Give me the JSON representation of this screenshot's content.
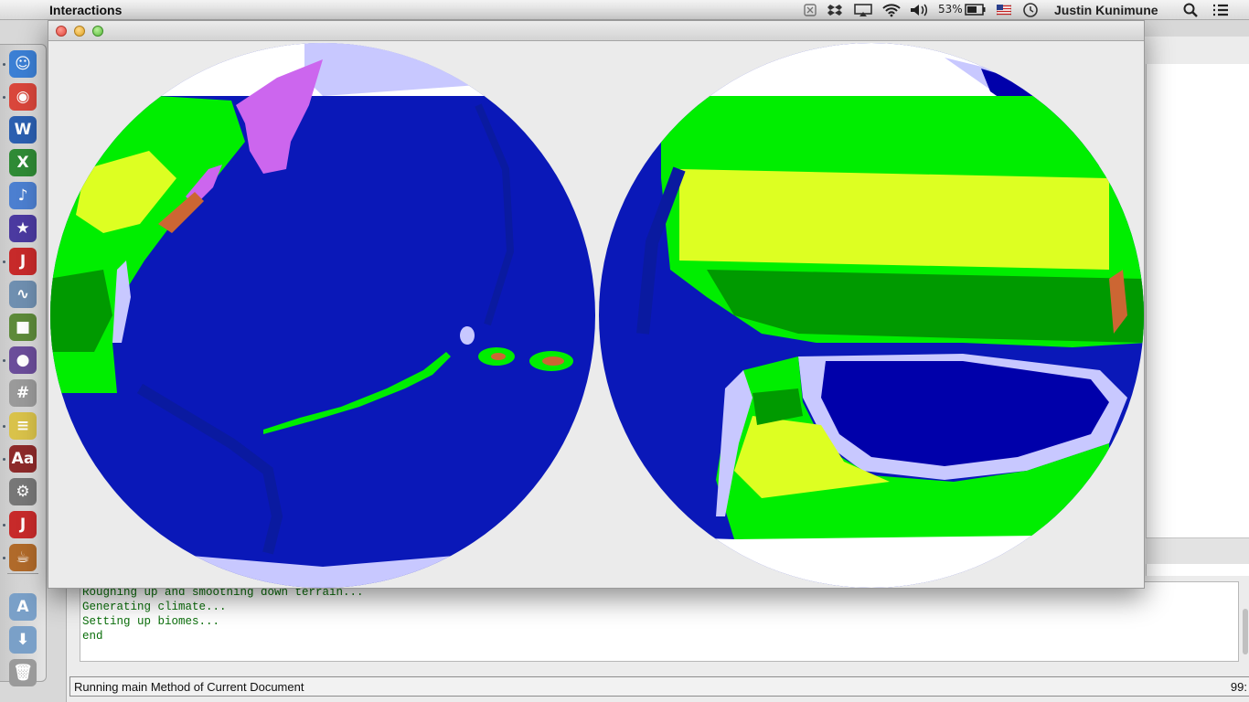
{
  "menubar": {
    "apple_glyph": "",
    "app_name": "Interactions",
    "battery_percent": "53%",
    "user_name": "Justin Kunimune",
    "status_icons": [
      "shield-icon",
      "dropbox-icon",
      "airplay-icon",
      "wifi-icon",
      "volume-icon",
      "battery-icon",
      "flag-icon",
      "clock-icon",
      "search-icon",
      "list-icon"
    ]
  },
  "dock": {
    "apps": [
      {
        "name": "finder",
        "glyph": "☺",
        "color": "#3b7fd4"
      },
      {
        "name": "chrome",
        "glyph": "◉",
        "color": "#d9463b"
      },
      {
        "name": "word",
        "glyph": "W",
        "color": "#2b5fb0"
      },
      {
        "name": "excel",
        "glyph": "X",
        "color": "#2f8a35"
      },
      {
        "name": "keynote",
        "glyph": "♪",
        "color": "#4c7fd0"
      },
      {
        "name": "imovie",
        "glyph": "★",
        "color": "#4b3aa0"
      },
      {
        "name": "drjava",
        "glyph": "J",
        "color": "#c72a2a"
      },
      {
        "name": "grapher",
        "glyph": "∿",
        "color": "#6f8fb0"
      },
      {
        "name": "minecraft",
        "glyph": "■",
        "color": "#5d8a3a"
      },
      {
        "name": "github",
        "glyph": "●",
        "color": "#6b4d9a"
      },
      {
        "name": "calculator",
        "glyph": "#",
        "color": "#9a9a9a"
      },
      {
        "name": "stickies",
        "glyph": "≡",
        "color": "#d9c24a"
      },
      {
        "name": "dictionary",
        "glyph": "Aa",
        "color": "#8d2a2a"
      },
      {
        "name": "system-preferences",
        "glyph": "⚙",
        "color": "#777777"
      },
      {
        "name": "drjava-2",
        "glyph": "J",
        "color": "#c72a2a"
      },
      {
        "name": "java",
        "glyph": "☕",
        "color": "#b06a2a"
      },
      {
        "name": "applications-folder",
        "glyph": "A",
        "color": "#7aa0c8"
      },
      {
        "name": "downloads-folder",
        "glyph": "⬇",
        "color": "#7aa0c8"
      },
      {
        "name": "trash",
        "glyph": "🗑",
        "color": "#9a9a9a"
      }
    ]
  },
  "window": {
    "title": ""
  },
  "map": {
    "colors": {
      "deep_ocean": "#0000aa",
      "ocean": "#0a18b8",
      "shelf": "#0a1aa0",
      "ice": "#c8c8ff",
      "snow": "#ffffff",
      "grassland": "#00ee00",
      "savanna": "#ddff22",
      "forest": "#009a00",
      "desert": "#cc6633",
      "mountain": "#cc66ee"
    }
  },
  "console": {
    "lines": [
      "Roughing up and smoothing down terrain...",
      "Generating climate...",
      "Setting up biomes...",
      "end"
    ]
  },
  "statusbar": {
    "message": "Running main Method of Current Document",
    "position": "99:"
  }
}
